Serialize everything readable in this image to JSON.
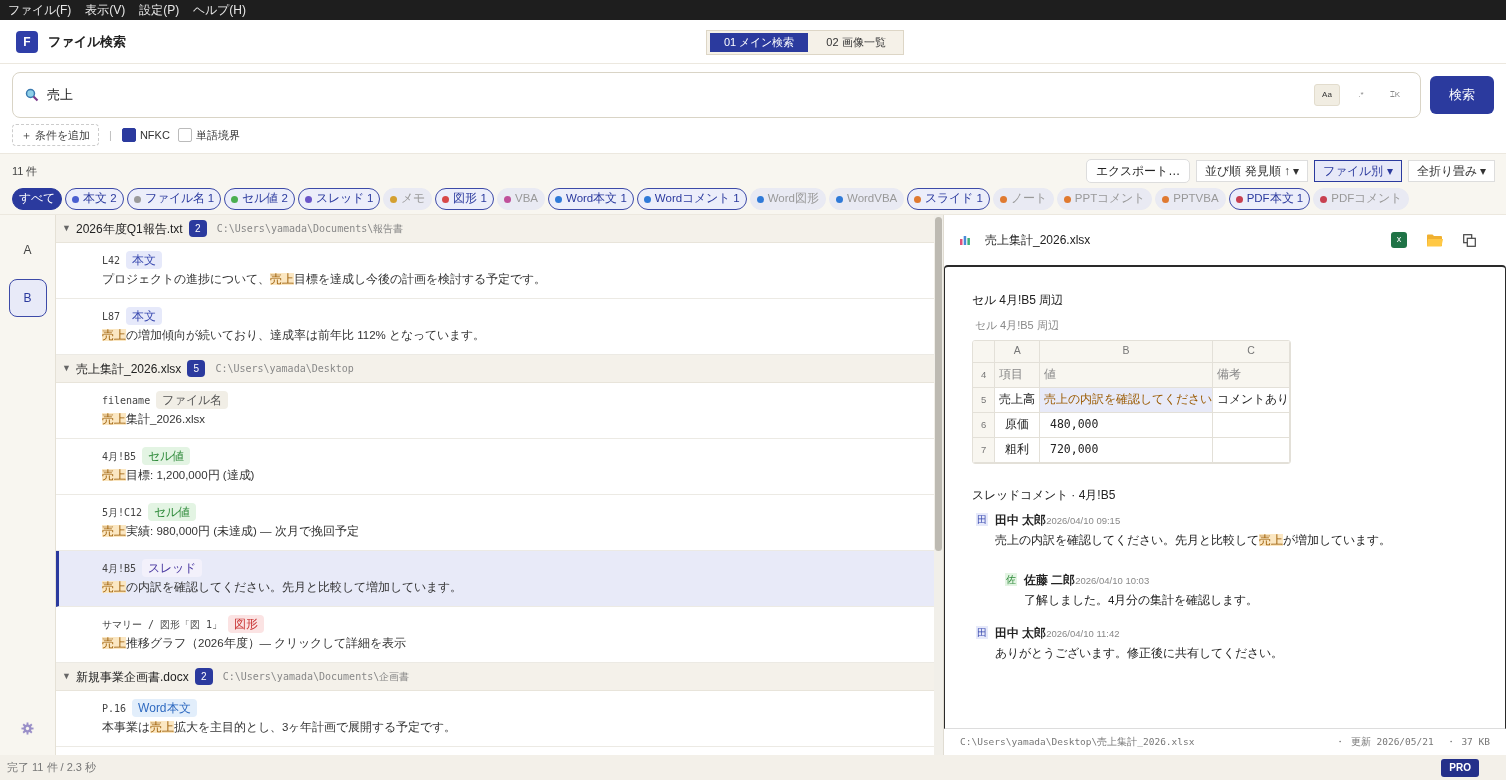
{
  "menu_bar": [
    "ファイル(F)",
    "表示(V)",
    "設定(P)",
    "ヘルプ(H)"
  ],
  "app": {
    "logo": "F",
    "title": "ファイル検索"
  },
  "view_tabs": [
    {
      "label": "01 メイン検索",
      "selected": true
    },
    {
      "label": "02 画像一覧",
      "selected": false
    }
  ],
  "search": {
    "value": "売上",
    "options": [
      {
        "label": "Aa",
        "on": true
      },
      {
        "label": ".*",
        "on": false
      },
      {
        "label": "⌶K",
        "on": false
      }
    ],
    "button": "検索"
  },
  "conditions": {
    "add": "＋ 条件を追加",
    "separator": "|",
    "checks": [
      {
        "label": "NFKC",
        "checked": true
      },
      {
        "label": "単語境界",
        "checked": false
      }
    ]
  },
  "results_toolbar": {
    "count": "11 件",
    "buttons": [
      {
        "label": "エクスポート…",
        "kind": "plain",
        "active": false
      },
      {
        "label": "並び順  発見順 ↑ ▾",
        "kind": "menu",
        "active": false
      },
      {
        "label": "ファイル別 ▾",
        "kind": "menu",
        "active": true
      },
      {
        "label": "全折り畳み ▾",
        "kind": "menu",
        "active": false
      }
    ]
  },
  "filters": [
    {
      "label": "すべて",
      "selected": true,
      "enabled": true
    },
    {
      "label": "本文 2",
      "color": "#4a5fd0",
      "selected": false,
      "enabled": true
    },
    {
      "label": "ファイル名 1",
      "color": "#9a9a9a",
      "selected": false,
      "enabled": true
    },
    {
      "label": "セル値 2",
      "color": "#4caf50",
      "selected": false,
      "enabled": true
    },
    {
      "label": "スレッド 1",
      "color": "#6a55c8",
      "selected": false,
      "enabled": true
    },
    {
      "label": "メモ",
      "color": "#d4a030",
      "selected": false,
      "enabled": false
    },
    {
      "label": "図形 1",
      "color": "#d84848",
      "selected": false,
      "enabled": true
    },
    {
      "label": "VBA",
      "color": "#c0509a",
      "selected": false,
      "enabled": false
    },
    {
      "label": "Word本文 1",
      "color": "#2f7ad8",
      "selected": false,
      "enabled": true
    },
    {
      "label": "Wordコメント 1",
      "color": "#2f7ad8",
      "selected": false,
      "enabled": true
    },
    {
      "label": "Word図形",
      "color": "#2f7ad8",
      "selected": false,
      "enabled": false
    },
    {
      "label": "WordVBA",
      "color": "#2f7ad8",
      "selected": false,
      "enabled": false
    },
    {
      "label": "スライド 1",
      "color": "#e07a30",
      "selected": false,
      "enabled": true
    },
    {
      "label": "ノート",
      "color": "#e07a30",
      "selected": false,
      "enabled": false
    },
    {
      "label": "PPTコメント",
      "color": "#e07a30",
      "selected": false,
      "enabled": false
    },
    {
      "label": "PPTVBA",
      "color": "#e07a30",
      "selected": false,
      "enabled": false
    },
    {
      "label": "PDF本文 1",
      "color": "#c84050",
      "selected": false,
      "enabled": true
    },
    {
      "label": "PDFコメント",
      "color": "#c84050",
      "selected": false,
      "enabled": false
    }
  ],
  "rail": [
    {
      "label": "A",
      "selected": false
    },
    {
      "label": "B",
      "selected": true
    }
  ],
  "groups": [
    {
      "caret": "▼",
      "name": "2026年度Q1報告.txt",
      "count": "2",
      "path": "C:\\Users\\yamada\\Documents\\報告書",
      "expanded": true,
      "hits": [
        {
          "location": "L42",
          "tag": "本文",
          "kind": "body",
          "selected": false,
          "segments": [
            {
              "text": "プロジェクトの進捗について、",
              "match": false
            },
            {
              "text": "売上",
              "match": true
            },
            {
              "text": "目標を達成し今後の計画を検討する予定です。",
              "match": false
            }
          ]
        },
        {
          "location": "L87",
          "tag": "本文",
          "kind": "body",
          "selected": false,
          "segments": [
            {
              "text": "売上",
              "match": true
            },
            {
              "text": "の増加傾向が続いており、達成率は前年比 112% となっています。",
              "match": false
            }
          ]
        }
      ]
    },
    {
      "caret": "▼",
      "name": "売上集計_2026.xlsx",
      "count": "5",
      "path": "C:\\Users\\yamada\\Desktop",
      "expanded": true,
      "hits": [
        {
          "location": "filename",
          "tag": "ファイル名",
          "kind": "filename",
          "selected": false,
          "segments": [
            {
              "text": "売上",
              "match": true
            },
            {
              "text": "集計_2026.xlsx",
              "match": false
            }
          ]
        },
        {
          "location": "4月!B5",
          "tag": "セル値",
          "kind": "cell",
          "selected": false,
          "segments": [
            {
              "text": "売上",
              "match": true
            },
            {
              "text": "目標: 1,200,000円 (達成)",
              "match": false
            }
          ]
        },
        {
          "location": "5月!C12",
          "tag": "セル値",
          "kind": "cell",
          "selected": false,
          "segments": [
            {
              "text": "売上",
              "match": true
            },
            {
              "text": "実績: 980,000円 (未達成) — 次月で挽回予定",
              "match": false
            }
          ]
        },
        {
          "location": "4月!B5",
          "tag": "スレッド",
          "kind": "thread",
          "selected": true,
          "segments": [
            {
              "text": "売上",
              "match": true
            },
            {
              "text": "の内訳を確認してください。先月と比較して増加しています。",
              "match": false
            }
          ]
        },
        {
          "location": "サマリー / 図形「図 1」",
          "tag": "図形",
          "kind": "shape",
          "selected": false,
          "segments": [
            {
              "text": "売上",
              "match": true
            },
            {
              "text": "推移グラフ（2026年度）— クリックして詳細を表示",
              "match": false
            }
          ]
        }
      ]
    },
    {
      "caret": "▼",
      "name": "新規事業企画書.docx",
      "count": "2",
      "path": "C:\\Users\\yamada\\Documents\\企画書",
      "expanded": true,
      "hits": [
        {
          "location": "P.16",
          "tag": "Word本文",
          "kind": "word_body",
          "selected": false,
          "segments": [
            {
              "text": "本事業は",
              "match": false
            },
            {
              "text": "売上",
              "match": true
            },
            {
              "text": "拡大を主目的とし、3ヶ年計画で展開する予定です。",
              "match": false
            }
          ]
        }
      ]
    }
  ],
  "preview": {
    "title": "売上集計_2026.xlsx",
    "excel_badge": "x",
    "heading": "セル 4月!B5 周辺",
    "caption": "セル 4月!B5 周辺",
    "sheet": {
      "columns": [
        "A",
        "B",
        "C"
      ],
      "rows": [
        {
          "number": "4",
          "kind": "header",
          "cells": [
            "項目",
            "値",
            "備考"
          ],
          "selected_cells": [
            false,
            false,
            false
          ]
        },
        {
          "number": "5",
          "kind": "data",
          "cells": [
            "売上高",
            "売上の内訳を確認してください",
            "コメントあり"
          ],
          "selected_cells": [
            false,
            true,
            false
          ]
        },
        {
          "number": "6",
          "kind": "data",
          "cells": [
            "原価",
            "480,000"
          ],
          "selected_cells": [
            false,
            false,
            false
          ]
        },
        {
          "number": "7",
          "kind": "data",
          "cells": [
            "粗利",
            "720,000"
          ],
          "selected_cells": [
            false,
            false,
            false
          ]
        }
      ]
    },
    "thread_title": "スレッドコメント · 4月!B5",
    "comments": [
      {
        "initial": "田",
        "author": "田中 太郎",
        "time": "2026/04/10 09:15",
        "reply": false,
        "segments": [
          {
            "text": "売上の内訳を確認してください。先月と比較して",
            "match": false
          },
          {
            "text": "売上",
            "match": true
          },
          {
            "text": "が増加しています。",
            "match": false
          }
        ]
      },
      {
        "initial": "佐",
        "author": "佐藤 二郎",
        "time": "2026/04/10 10:03",
        "reply": true,
        "segments": [
          {
            "text": "了解しました。4月分の集計を確認します。",
            "match": false
          }
        ]
      },
      {
        "initial": "田",
        "author": "田中 太郎",
        "time": "2026/04/10 11:42",
        "reply": false,
        "segments": [
          {
            "text": "ありがとうございます。修正後に共有してください。",
            "match": false
          }
        ]
      }
    ],
    "footer_path": "C:\\Users\\yamada\\Desktop\\売上集計_2026.xlsx",
    "footer_updated": "・  更新 2026/05/21",
    "footer_size": "・  37 KB"
  },
  "status_bar": {
    "text": "完了  11 件 / 2.3 秒",
    "badge": "PRO"
  }
}
